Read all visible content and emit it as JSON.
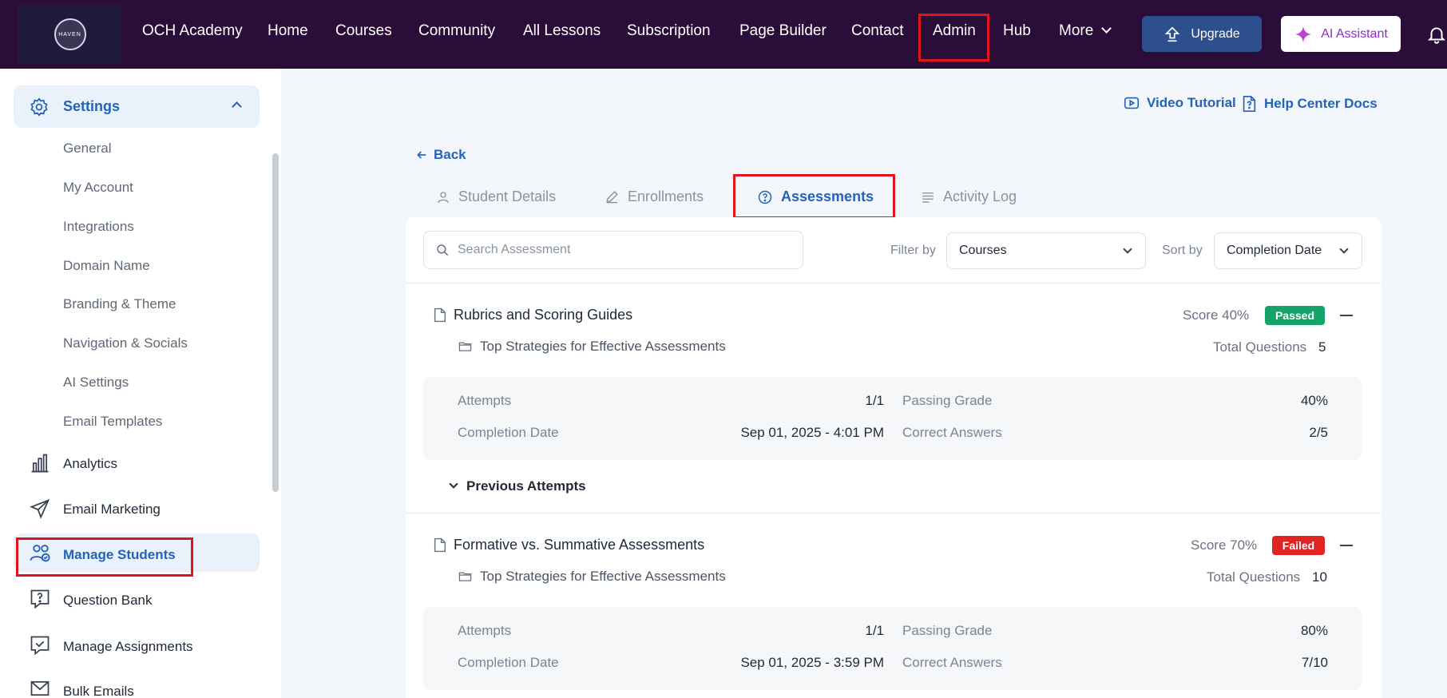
{
  "topnav": {
    "logo_text": "HAVEN",
    "links": [
      "OCH Academy",
      "Home",
      "Courses",
      "Community",
      "All Lessons",
      "Subscription",
      "Page Builder",
      "Contact",
      "Admin",
      "Hub",
      "More"
    ],
    "upgrade_label": "Upgrade",
    "ai_label": "AI Assistant",
    "bg_color": "#2b0d3a"
  },
  "sidebar": {
    "settings_label": "Settings",
    "settings_items": [
      "General",
      "My Account",
      "Integrations",
      "Domain Name",
      "Branding & Theme",
      "Navigation & Socials",
      "AI Settings",
      "Email Templates"
    ],
    "items": [
      "Analytics",
      "Email Marketing",
      "Manage Students",
      "Question Bank",
      "Manage Assignments",
      "Bulk Emails"
    ],
    "active_item": "Manage Students"
  },
  "help": {
    "video_label": "Video Tutorial",
    "docs_label": "Help Center Docs"
  },
  "back_label": "Back",
  "tabs": [
    "Student Details",
    "Enrollments",
    "Assessments",
    "Activity Log"
  ],
  "active_tab": "Assessments",
  "filters": {
    "search_placeholder": "Search Assessment",
    "filter_label": "Filter by",
    "filter_value": "Courses",
    "sort_label": "Sort by",
    "sort_value": "Completion Date"
  },
  "assessments": [
    {
      "title": "Rubrics and Scoring Guides",
      "course": "Top Strategies for Effective Assessments",
      "score": "Score 40%",
      "status": "Passed",
      "total_questions_label": "Total Questions",
      "total_questions": "5",
      "attempts_label": "Attempts",
      "attempts": "1/1",
      "completion_label": "Completion Date",
      "completion": "Sep 01, 2025 - 4:01 PM",
      "passing_label": "Passing Grade",
      "passing": "40%",
      "correct_label": "Correct Answers",
      "correct": "2/5",
      "previous_label": "Previous Attempts"
    },
    {
      "title": "Formative vs. Summative Assessments",
      "course": "Top Strategies for Effective Assessments",
      "score": "Score 70%",
      "status": "Failed",
      "total_questions_label": "Total Questions",
      "total_questions": "10",
      "attempts_label": "Attempts",
      "attempts": "1/1",
      "completion_label": "Completion Date",
      "completion": "Sep 01, 2025 - 3:59 PM",
      "passing_label": "Passing Grade",
      "passing": "80%",
      "correct_label": "Correct Answers",
      "correct": "7/10"
    }
  ],
  "colors": {
    "accent": "#2563b8",
    "passed": "#16a36a",
    "failed": "#e02424",
    "highlight": "#e0151c"
  }
}
